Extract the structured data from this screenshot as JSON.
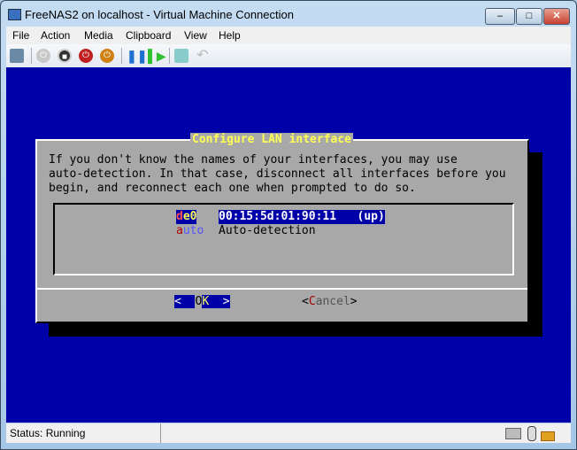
{
  "window": {
    "title": "FreeNAS2 on localhost - Virtual Machine Connection",
    "min": "–",
    "max": "□",
    "close": "✕"
  },
  "menu": [
    "File",
    "Action",
    "Media",
    "Clipboard",
    "View",
    "Help"
  ],
  "toolbar": [
    "ctrl-alt-del",
    "start",
    "turn-off",
    "shut-down",
    "save",
    "pause",
    "reset",
    "snapshot",
    "revert"
  ],
  "dialog": {
    "title": "Configure LAN interface",
    "message": [
      "If you don't know the names of your interfaces, you may use",
      "auto-detection. In that case, disconnect all interfaces before you",
      "begin, and reconnect each one when prompted to do so."
    ],
    "items": [
      {
        "tag_first": "d",
        "tag_rest": "e0",
        "desc": "00:15:5d:01:90:11   (up)"
      },
      {
        "tag_first": "a",
        "tag_rest": "uto",
        "desc": "Auto-detection"
      }
    ],
    "ok": {
      "left": "<  ",
      "first": "O",
      "rest": "K",
      "right": "  >"
    },
    "cancel": {
      "left": "<",
      "first": "C",
      "rest": "ancel",
      "right": ">"
    }
  },
  "status": {
    "text": "Status: Running"
  }
}
